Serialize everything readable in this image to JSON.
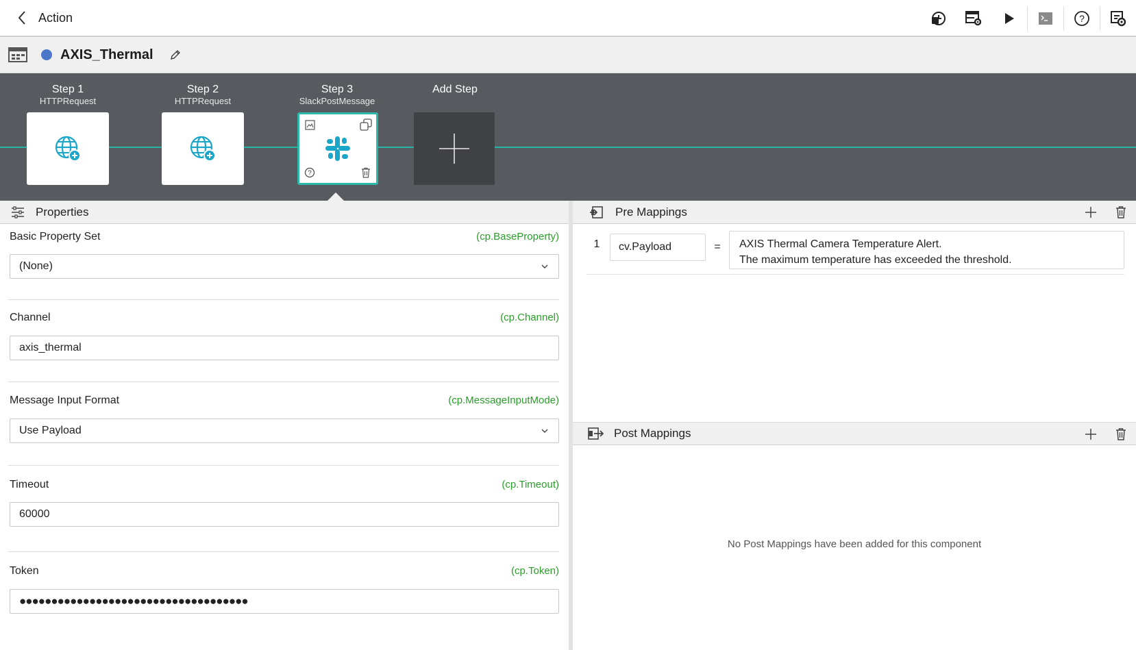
{
  "topbar": {
    "title": "Action",
    "tools": [
      "deploy-icon",
      "settings-grid-icon",
      "play-icon",
      "console-icon",
      "help-icon",
      "config-icon"
    ]
  },
  "component": {
    "name": "AXIS_Thermal",
    "status_color": "#4f77c9"
  },
  "steps": [
    {
      "title": "Step 1",
      "subtitle": "HTTPRequest",
      "icon": "globe-add-icon"
    },
    {
      "title": "Step 2",
      "subtitle": "HTTPRequest",
      "icon": "globe-add-icon"
    },
    {
      "title": "Step 3",
      "subtitle": "SlackPostMessage",
      "icon": "slack-icon",
      "active": true
    }
  ],
  "add_step": {
    "title": "Add Step"
  },
  "properties": {
    "title": "Properties",
    "fields": [
      {
        "label": "Basic Property Set",
        "key": "(cp.BaseProperty)",
        "value": "(None)",
        "type": "select"
      },
      {
        "label": "Channel",
        "key": "(cp.Channel)",
        "value": "axis_thermal",
        "type": "text"
      },
      {
        "label": "Message Input Format",
        "key": "(cp.MessageInputMode)",
        "value": "Use Payload",
        "type": "select"
      },
      {
        "label": "Timeout",
        "key": "(cp.Timeout)",
        "value": "60000",
        "type": "text"
      },
      {
        "label": "Token",
        "key": "(cp.Token)",
        "value": "●●●●●●●●●●●●●●●●●●●●●●●●●●●●●●●●●●●●",
        "type": "password"
      }
    ]
  },
  "pre_mappings": {
    "title": "Pre Mappings",
    "rows": [
      {
        "index": "1",
        "target": "cv.Payload",
        "operator": "=",
        "value_line1": "AXIS Thermal Camera Temperature Alert.",
        "value_line2": "The maximum temperature has exceeded the threshold."
      }
    ]
  },
  "post_mappings": {
    "title": "Post Mappings",
    "empty_message": "No Post Mappings have been added for this component"
  },
  "colors": {
    "accent": "#2bb8a9",
    "key_text": "#2a9d2a",
    "strip_bg": "#575a5e"
  }
}
